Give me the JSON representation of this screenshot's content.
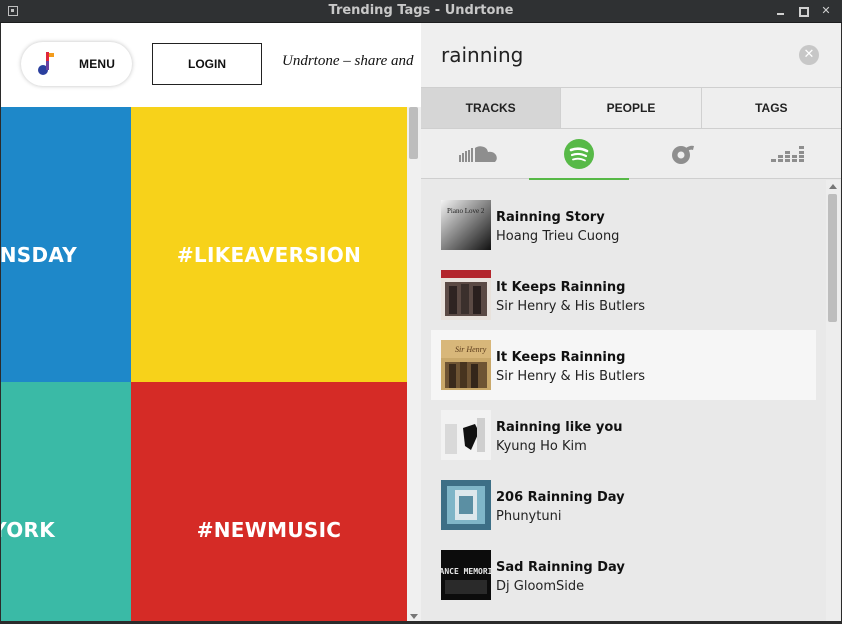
{
  "window": {
    "title": "Trending Tags - Undrtone"
  },
  "header": {
    "menu_label": "MENU",
    "login_label": "LOGIN",
    "tagline": "Undrtone – share and"
  },
  "tiles": [
    {
      "label": "ANSDAY",
      "color": "#1e88c9"
    },
    {
      "label": "#LIKEAVERSION",
      "color": "#f7d21a"
    },
    {
      "label": "YORK",
      "color": "#3abaa6"
    },
    {
      "label": "#NEWMUSIC",
      "color": "#d52b26"
    }
  ],
  "search": {
    "query": "rainning"
  },
  "tabs": [
    {
      "label": "TRACKS",
      "active": true
    },
    {
      "label": "PEOPLE",
      "active": false
    },
    {
      "label": "TAGS",
      "active": false
    }
  ],
  "services": [
    {
      "icon": "soundcloud-icon",
      "active": false
    },
    {
      "icon": "spotify-icon",
      "active": true,
      "color": "#57b947"
    },
    {
      "icon": "rdio-icon",
      "active": false
    },
    {
      "icon": "deezer-icon",
      "active": false
    }
  ],
  "results": [
    {
      "title": "Rainning Story",
      "artist": "Hoang Trieu Cuong",
      "cover_text": "Piano Love 2"
    },
    {
      "title": "It Keeps Rainning",
      "artist": "Sir Henry & His Butlers"
    },
    {
      "title": "It Keeps Rainning",
      "artist": "Sir Henry & His Butlers",
      "cover_text": "Sir Henry",
      "highlighted": true
    },
    {
      "title": "Rainning like you",
      "artist": "Kyung Ho Kim"
    },
    {
      "title": "206 Rainning Day",
      "artist": "Phunytuni"
    },
    {
      "title": "Sad Rainning Day",
      "artist": "Dj GloomSide",
      "cover_text": "TRANCE MEMORIES"
    }
  ]
}
